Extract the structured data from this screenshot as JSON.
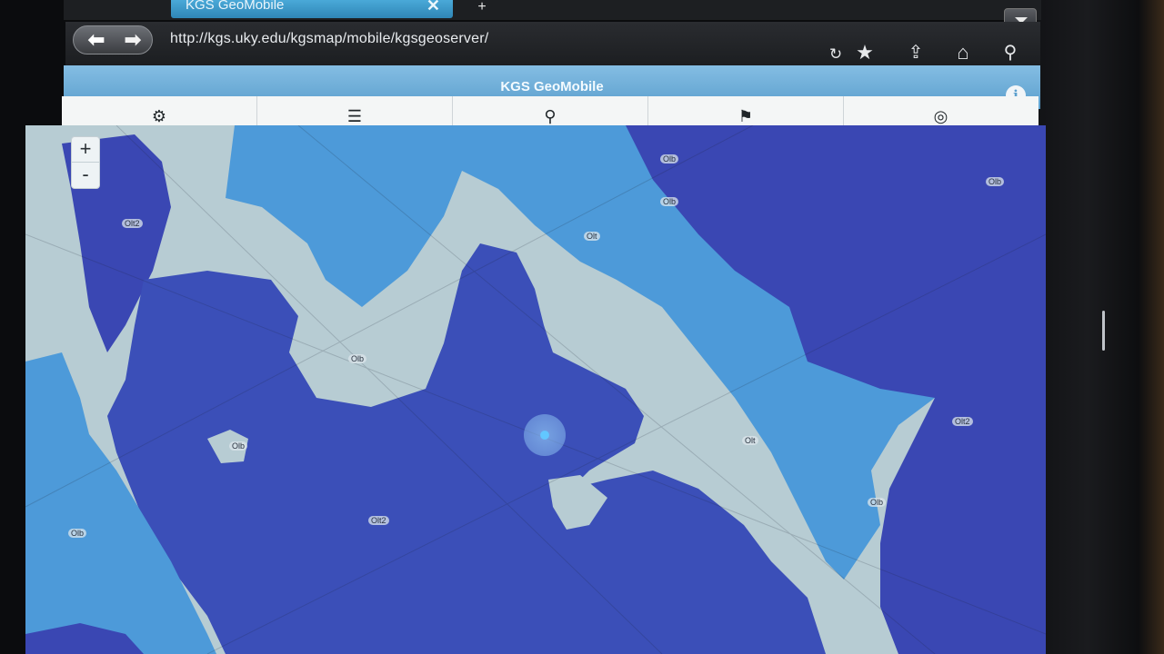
{
  "browser": {
    "tab_title": "KGS GeoMobile",
    "tab_close": "✕",
    "new_tab": "+",
    "url": "http://kgs.uky.edu/kgsmap/mobile/kgsgeoserver/",
    "icons": [
      "back-icon",
      "forward-icon",
      "reload-icon",
      "star-icon",
      "share-icon",
      "home-icon",
      "search-icon",
      "menu-dropdown-icon"
    ]
  },
  "app": {
    "title": "KGS GeoMobile",
    "info_glyph": "i",
    "toolbar": {
      "items": [
        {
          "name": "settings",
          "glyph": "⚙"
        },
        {
          "name": "layers-list",
          "glyph": "☰"
        },
        {
          "name": "pin",
          "glyph": "⚲"
        },
        {
          "name": "flag",
          "glyph": "⚑"
        },
        {
          "name": "locate",
          "glyph": "◎"
        }
      ]
    }
  },
  "map": {
    "zoom_in": "+",
    "zoom_out": "-",
    "unit_labels": [
      {
        "text": "Olb"
      },
      {
        "text": "Olb"
      },
      {
        "text": "Olb"
      },
      {
        "text": "Olb"
      },
      {
        "text": "Olb"
      },
      {
        "text": "Olb"
      },
      {
        "text": "Olt"
      },
      {
        "text": "Olt"
      },
      {
        "text": "Olt2"
      },
      {
        "text": "Olt2"
      },
      {
        "text": "Olt2"
      },
      {
        "text": "Olb"
      }
    ],
    "colors": {
      "dark_unit": "#3b4fb8",
      "mid_unit": "#3f8fd6",
      "light_unit": "#b9cfd6",
      "location": "#62c7ff"
    }
  }
}
